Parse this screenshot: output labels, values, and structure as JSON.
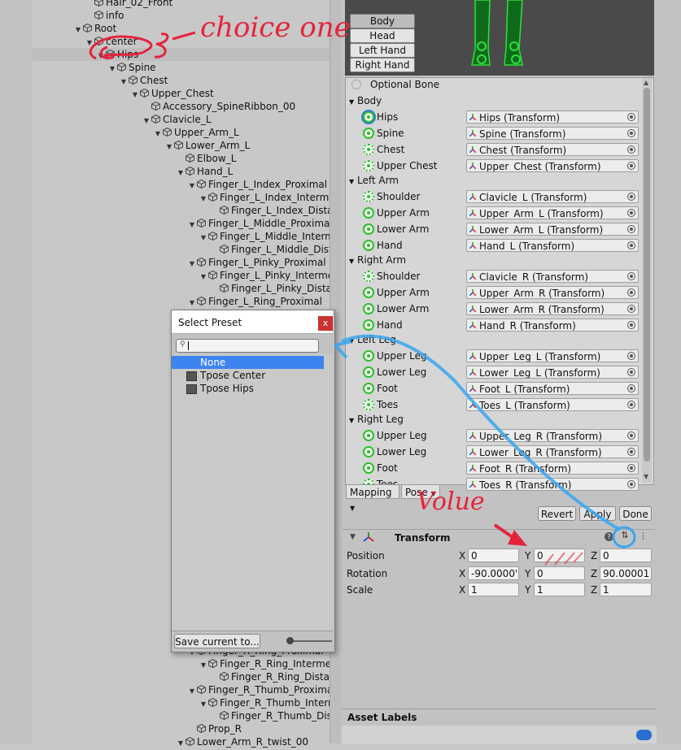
{
  "hierarchy": {
    "items": [
      {
        "label": "Hair_02_Front",
        "indent": 0,
        "arrow": false
      },
      {
        "label": "info",
        "indent": 0,
        "arrow": false
      },
      {
        "label": "Root",
        "indent": -1,
        "arrow": true
      },
      {
        "label": "center",
        "indent": 0,
        "arrow": true
      },
      {
        "label": "Hips",
        "indent": 1,
        "arrow": true
      },
      {
        "label": "Spine",
        "indent": 2,
        "arrow": true
      },
      {
        "label": "Chest",
        "indent": 3,
        "arrow": true
      },
      {
        "label": "Upper_Chest",
        "indent": 4,
        "arrow": true
      },
      {
        "label": "Accessory_SpineRibbon_00",
        "indent": 5,
        "arrow": false
      },
      {
        "label": "Clavicle_L",
        "indent": 5,
        "arrow": true
      },
      {
        "label": "Upper_Arm_L",
        "indent": 6,
        "arrow": true
      },
      {
        "label": "Lower_Arm_L",
        "indent": 7,
        "arrow": true
      },
      {
        "label": "Elbow_L",
        "indent": 8,
        "arrow": false
      },
      {
        "label": "Hand_L",
        "indent": 8,
        "arrow": true
      },
      {
        "label": "Finger_L_Index_Proximal",
        "indent": 9,
        "arrow": true
      },
      {
        "label": "Finger_L_Index_Intermediate",
        "indent": 10,
        "arrow": true
      },
      {
        "label": "Finger_L_Index_Distal",
        "indent": 11,
        "arrow": false
      },
      {
        "label": "Finger_L_Middle_Proximal",
        "indent": 9,
        "arrow": true
      },
      {
        "label": "Finger_L_Middle_Intermediate",
        "indent": 10,
        "arrow": true
      },
      {
        "label": "Finger_L_Middle_Distal",
        "indent": 11,
        "arrow": false
      },
      {
        "label": "Finger_L_Pinky_Proximal",
        "indent": 9,
        "arrow": true
      },
      {
        "label": "Finger_L_Pinky_Intermediate",
        "indent": 10,
        "arrow": true
      },
      {
        "label": "Finger_L_Pinky_Distal",
        "indent": 11,
        "arrow": false
      },
      {
        "label": "Finger_L_Ring_Proximal",
        "indent": 9,
        "arrow": true
      }
    ],
    "bottom_items": [
      {
        "label": "Finger_R_Ring_Proximal",
        "indent": 9,
        "arrow": true
      },
      {
        "label": "Finger_R_Ring_Intermediate",
        "indent": 10,
        "arrow": true
      },
      {
        "label": "Finger_R_Ring_Distal",
        "indent": 11,
        "arrow": false
      },
      {
        "label": "Finger_R_Thumb_Proximal",
        "indent": 9,
        "arrow": true
      },
      {
        "label": "Finger_R_Thumb_Intermediate",
        "indent": 10,
        "arrow": true
      },
      {
        "label": "Finger_R_Thumb_Distal",
        "indent": 11,
        "arrow": false
      },
      {
        "label": "Prop_R",
        "indent": 9,
        "arrow": false
      },
      {
        "label": "Lower_Arm_R_twist_00",
        "indent": 8,
        "arrow": true
      }
    ]
  },
  "avatar": {
    "tabs": [
      "Body",
      "Head",
      "Left Hand",
      "Right Hand"
    ],
    "active_tab": "Body"
  },
  "bones": {
    "optional_label": "Optional Bone",
    "groups": [
      {
        "name": "Body",
        "bones": [
          {
            "name": "Hips",
            "value": "Hips (Transform)",
            "dashed": false,
            "selected": true
          },
          {
            "name": "Spine",
            "value": "Spine (Transform)",
            "dashed": false
          },
          {
            "name": "Chest",
            "value": "Chest (Transform)",
            "dashed": true
          },
          {
            "name": "Upper Chest",
            "value": "Upper_Chest (Transform)",
            "dashed": true
          }
        ]
      },
      {
        "name": "Left Arm",
        "bones": [
          {
            "name": "Shoulder",
            "value": "Clavicle_L (Transform)",
            "dashed": true
          },
          {
            "name": "Upper Arm",
            "value": "Upper_Arm_L (Transform)",
            "dashed": false
          },
          {
            "name": "Lower Arm",
            "value": "Lower_Arm_L (Transform)",
            "dashed": false
          },
          {
            "name": "Hand",
            "value": "Hand_L (Transform)",
            "dashed": false
          }
        ]
      },
      {
        "name": "Right Arm",
        "bones": [
          {
            "name": "Shoulder",
            "value": "Clavicle_R (Transform)",
            "dashed": true
          },
          {
            "name": "Upper Arm",
            "value": "Upper_Arm_R (Transform)",
            "dashed": false
          },
          {
            "name": "Lower Arm",
            "value": "Lower_Arm_R (Transform)",
            "dashed": false
          },
          {
            "name": "Hand",
            "value": "Hand_R (Transform)",
            "dashed": false
          }
        ]
      },
      {
        "name": "Left Leg",
        "bones": [
          {
            "name": "Upper Leg",
            "value": "Upper_Leg_L (Transform)",
            "dashed": false
          },
          {
            "name": "Lower Leg",
            "value": "Lower_Leg_L (Transform)",
            "dashed": false
          },
          {
            "name": "Foot",
            "value": "Foot_L (Transform)",
            "dashed": false
          },
          {
            "name": "Toes",
            "value": "Toes_L (Transform)",
            "dashed": true
          }
        ]
      },
      {
        "name": "Right Leg",
        "bones": [
          {
            "name": "Upper Leg",
            "value": "Upper_Leg_R (Transform)",
            "dashed": false
          },
          {
            "name": "Lower Leg",
            "value": "Lower_Leg_R (Transform)",
            "dashed": false
          },
          {
            "name": "Foot",
            "value": "Foot_R (Transform)",
            "dashed": false
          },
          {
            "name": "Toes",
            "value": "Toes_R (Transform)",
            "dashed": true
          }
        ]
      }
    ]
  },
  "toolbar": {
    "mapping_label": "Mapping",
    "pose_label": "Pose",
    "revert_label": "Revert",
    "apply_label": "Apply",
    "done_label": "Done"
  },
  "transform": {
    "title": "Transform",
    "position": {
      "label": "Position",
      "x": "0",
      "y": "0",
      "z": "0"
    },
    "rotation": {
      "label": "Rotation",
      "x": "-90.0000'",
      "y": "0",
      "z": "90.00001"
    },
    "scale": {
      "label": "Scale",
      "x": "1",
      "y": "1",
      "z": "1"
    },
    "axis_x": "X",
    "axis_y": "Y",
    "axis_z": "Z"
  },
  "asset_labels": "Asset Labels",
  "preset_popup": {
    "title": "Select Preset",
    "close": "x",
    "search_value": "",
    "items": [
      {
        "label": "None",
        "selected": true,
        "icon": false
      },
      {
        "label": "Tpose Center",
        "selected": false,
        "icon": true
      },
      {
        "label": "Tpose Hips",
        "selected": false,
        "icon": true
      }
    ],
    "save_label": "Save current to..."
  },
  "annotations": {
    "choice": "choice one",
    "value": "Volue"
  },
  "colors": {
    "bone_green": "#26c026",
    "selection_blue": "#3d84f0",
    "annotation_red": "#e5243b",
    "annotation_blue": "#3aa6f0",
    "avatar_bg": "#4a4a4a"
  }
}
